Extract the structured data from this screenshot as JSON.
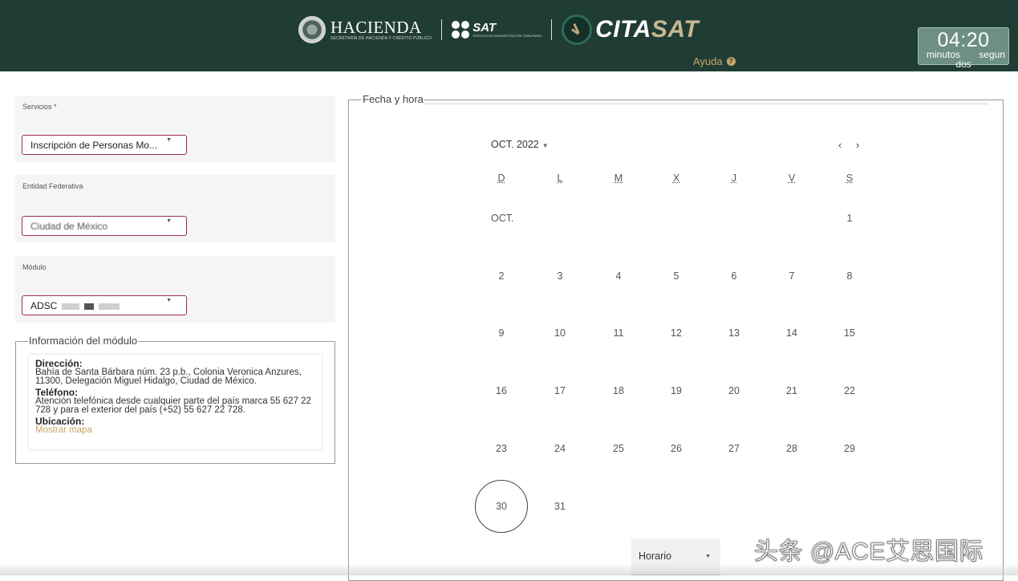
{
  "header": {
    "hacienda_title": "HACIENDA",
    "hacienda_subtitle": "SECRETARÍA DE HACIENDA Y CRÉDITO PÚBLICO",
    "sat_title": "SAT",
    "sat_subtitle": "SERVICIO DE ADMINISTRACIÓN TRIBUTARIA",
    "app_name_part1": "CITA",
    "app_name_part2": "SAT",
    "help_label": "Ayuda",
    "help_icon": "question-circle-icon",
    "timer": {
      "time": "04:20",
      "minutes_label": "minutos",
      "seconds_label_part1": "segun",
      "seconds_label_part2": "dos"
    }
  },
  "form": {
    "servicios": {
      "label": "Servicios *",
      "value": "Inscripción de Personas Mo..."
    },
    "entidad": {
      "label": "Entidad Federativa",
      "value": "Ciudad de México"
    },
    "modulo": {
      "label": "Módulo",
      "value": "ADSC"
    }
  },
  "module_info": {
    "legend": "Información del módulo",
    "address_heading": "Dirección:",
    "address": "Bahía de Santa Bárbara núm. 23 p.b., Colonia Veronica Anzures, 11300, Delegación Miguel Hidalgo, Ciudad de México.",
    "phone_heading": "Teléfono:",
    "phone": "Atención telefónica desde cualquier parte del país marca 55 627 22 728 y para el exterior del país (+52) 55 627 22 728.",
    "location_heading": "Ubicación:",
    "map_link": "Mostrar mapa"
  },
  "calendar": {
    "legend": "Fecha y hora",
    "month_label": "OCT. 2022",
    "prev_icon": "chevron-left-icon",
    "next_icon": "chevron-right-icon",
    "weekdays": [
      "D",
      "L",
      "M",
      "X",
      "J",
      "V",
      "S"
    ],
    "first_row_label": "OCT.",
    "weeks": [
      [
        "",
        "",
        "",
        "",
        "",
        "",
        "1"
      ],
      [
        "2",
        "3",
        "4",
        "5",
        "6",
        "7",
        "8"
      ],
      [
        "9",
        "10",
        "11",
        "12",
        "13",
        "14",
        "15"
      ],
      [
        "16",
        "17",
        "18",
        "19",
        "20",
        "21",
        "22"
      ],
      [
        "23",
        "24",
        "25",
        "26",
        "27",
        "28",
        "29"
      ],
      [
        "30",
        "31",
        "",
        "",
        "",
        "",
        ""
      ]
    ],
    "selected_day": "30",
    "horario_label": "Horario"
  },
  "watermark": "头条 @ACE艾思国际",
  "colors": {
    "header_bg": "#203d35",
    "accent_gold": "#c8a86a",
    "select_border": "#9b2d4a",
    "timer_bg": "#6e8f84"
  }
}
